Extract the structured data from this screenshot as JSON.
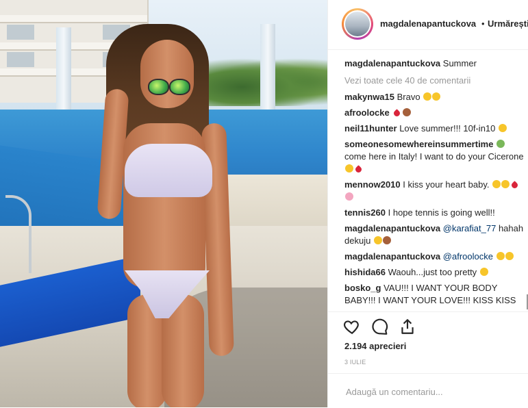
{
  "post": {
    "author": "magdalenapantuckova",
    "separator": "•",
    "follow_label": "Urmărești",
    "caption_user": "magdalenapantuckova",
    "caption_text": "Summer",
    "view_all": "Vezi toate cele 40 de comentarii"
  },
  "comments": [
    {
      "user": "makynwa15",
      "text": "Bravo"
    },
    {
      "user": "afroolocke",
      "text": ""
    },
    {
      "user": "neil11hunter",
      "text": "Love summer!!! 10f-in10"
    },
    {
      "user": "someonesomewhereinsummertime",
      "text": "come here in Italy! I want to do your Cicerone"
    },
    {
      "user": "mennow2010",
      "text": "I kiss your heart baby."
    },
    {
      "user": "tennis260",
      "text": "I hope tennis is going well!!"
    },
    {
      "user": "magdalenapantuckova",
      "mention": "@karafiat_77",
      "text": "hahah dekuju"
    },
    {
      "user": "magdalenapantuckova",
      "mention": "@afroolocke",
      "text": ""
    },
    {
      "user": "hishida66",
      "text": "Waouh...just too pretty"
    },
    {
      "user": "bosko_g",
      "text": "VAU!!! I WANT YOUR BODY BABY!!! I WANT YOUR LOVE!!! KISS KISS"
    }
  ],
  "stats": {
    "likes": "2.194 aprecieri",
    "date": "3 IULIE"
  },
  "comment_input": {
    "placeholder": "Adaugă un comentariu..."
  },
  "icons": [
    "heart-icon",
    "comment-icon",
    "share-icon"
  ]
}
